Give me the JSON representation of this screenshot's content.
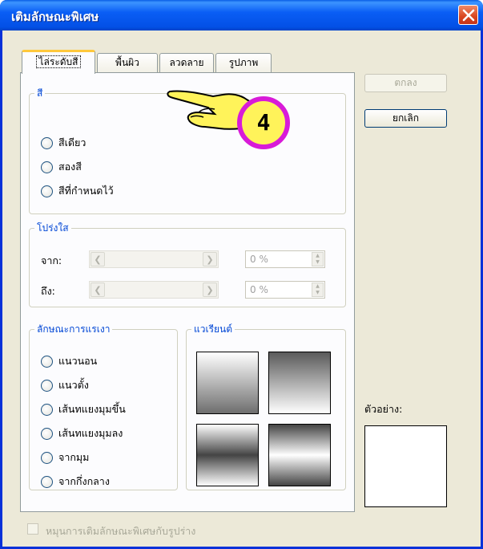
{
  "window": {
    "title": "เติมลักษณะพิเศษ",
    "close_icon": "close-icon"
  },
  "tabs": [
    {
      "label": "ไล่ระดับสี",
      "active": true
    },
    {
      "label": "พื้นผิว",
      "active": false
    },
    {
      "label": "ลวดลาย",
      "active": false
    },
    {
      "label": "รูปภาพ",
      "active": false
    }
  ],
  "colors_group": {
    "legend": "สี",
    "options": [
      "สีเดียว",
      "สองสี",
      "สีที่กำหนดไว้"
    ]
  },
  "transparency_group": {
    "legend": "โปร่งใส",
    "from_label": "จาก:",
    "from_value": "0 %",
    "to_label": "ถึง:",
    "to_value": "0 %"
  },
  "shading_group": {
    "legend": "ลักษณะการแรเงา",
    "options": [
      "แนวนอน",
      "แนวตั้ง",
      "เส้นทแยงมุมขึ้น",
      "เส้นทแยงมุมลง",
      "จากมุม",
      "จากกึ่งกลาง"
    ]
  },
  "variants_group": {
    "legend": "แวเรียนต์"
  },
  "buttons": {
    "ok": "ตกลง",
    "cancel": "ยกเลิก"
  },
  "preview_label": "ตัวอย่าง:",
  "rotate_checkbox_label": "หมุนการเติมลักษณะพิเศษกับรูปร่าง",
  "annotation": {
    "step_number": "4"
  },
  "accent": {
    "title_blue": "#0a5ef5",
    "legend_blue": "#0046d5",
    "tab_highlight": "#ffc83c",
    "callout_ring": "#d81bd8",
    "callout_fill": "#fff35a"
  }
}
